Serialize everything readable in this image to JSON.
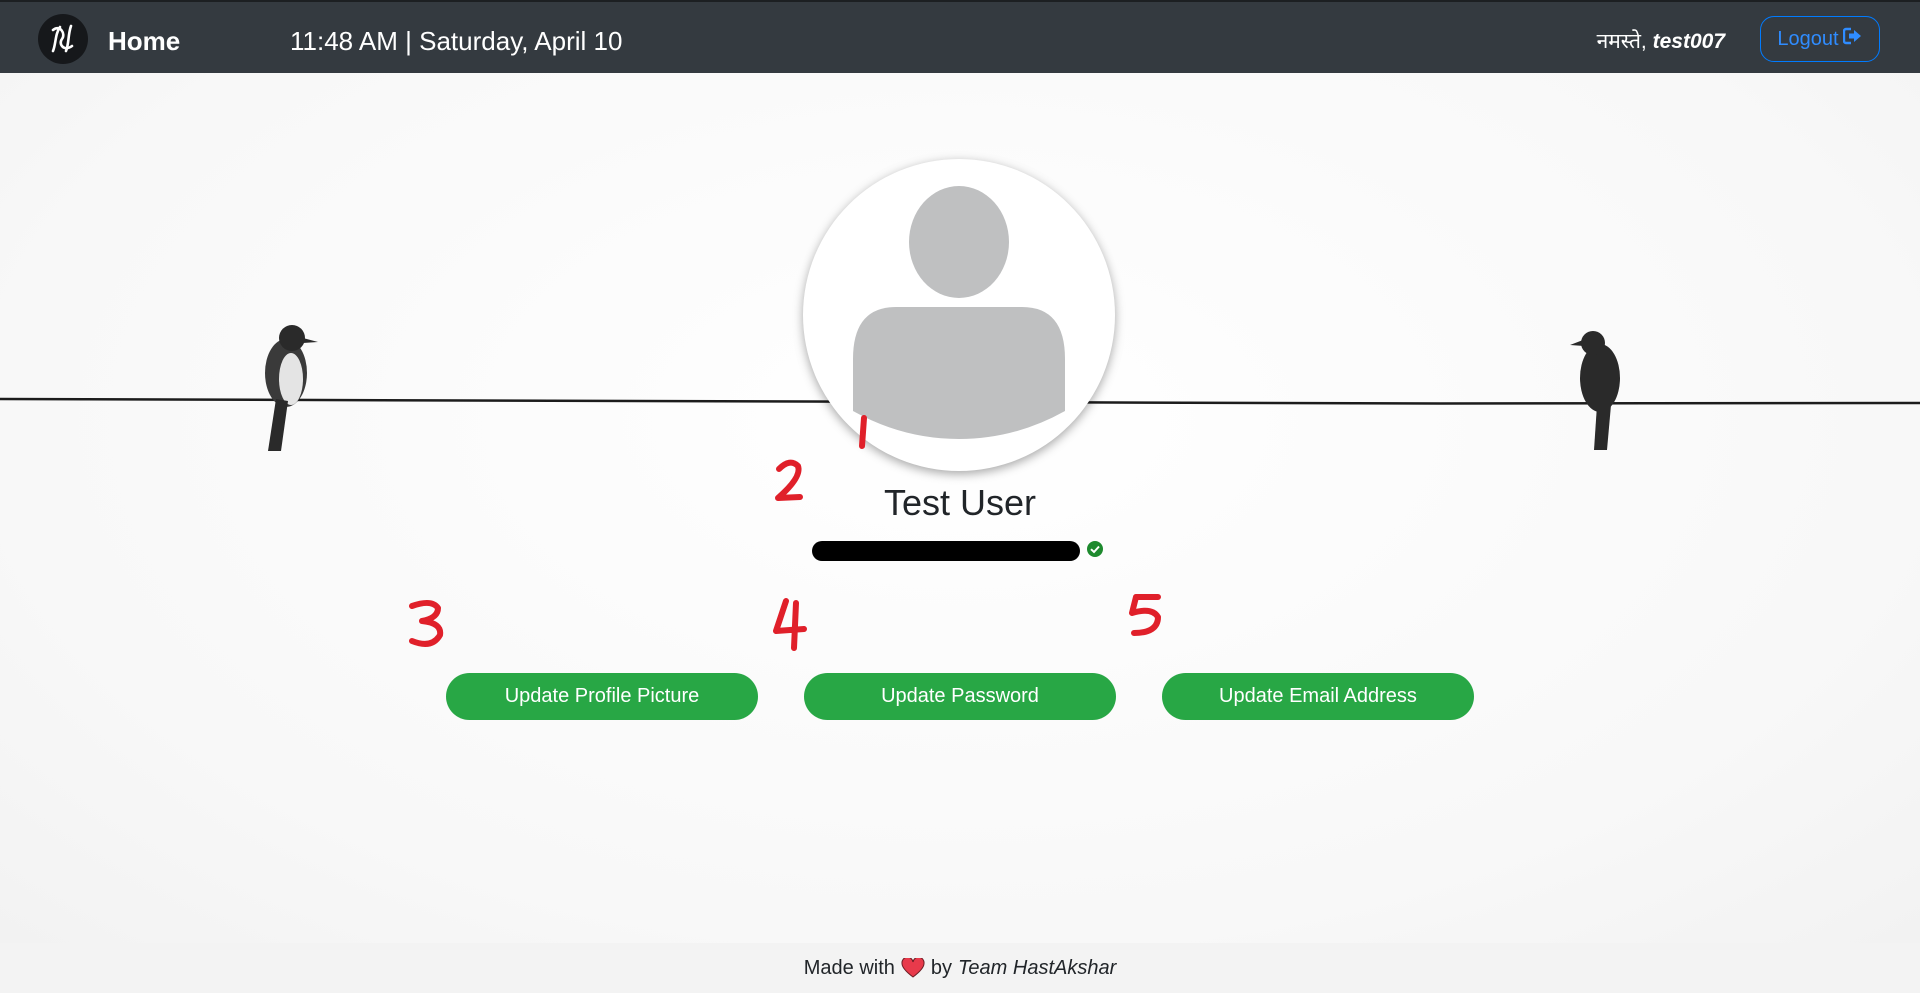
{
  "navbar": {
    "brand": "Home",
    "datetime": "11:48 AM | Saturday, April 10",
    "greeting_prefix": "नमस्ते, ",
    "username": "test007",
    "logout_label": "Logout"
  },
  "profile": {
    "name": "Test User",
    "email_redacted": true,
    "email_verified": true
  },
  "actions": {
    "update_picture": "Update Profile Picture",
    "update_password": "Update Password",
    "update_email": "Update Email Address"
  },
  "annotations": [
    "1",
    "2",
    "3",
    "4",
    "5"
  ],
  "footer": {
    "prefix": "Made with",
    "middle": "by",
    "team": "Team HastAkshar"
  },
  "colors": {
    "navbar_bg": "#343a40",
    "accent_green": "#28a745",
    "logout_blue": "#007bff",
    "annotation_red": "#e0202a",
    "verified_green": "#1e8a2e"
  },
  "icons": [
    "hastakshar-logo-icon",
    "sign-out-icon",
    "user-silhouette-icon",
    "check-circle-icon",
    "heart-icon"
  ]
}
